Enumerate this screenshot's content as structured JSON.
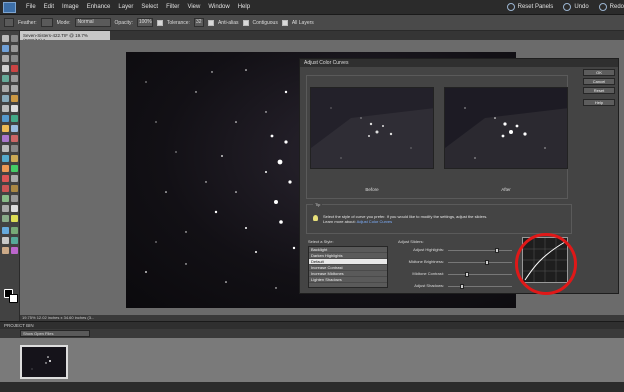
{
  "menubar": {
    "items": [
      "File",
      "Edit",
      "Image",
      "Enhance",
      "Layer",
      "Select",
      "Filter",
      "View",
      "Window",
      "Help"
    ],
    "right": [
      {
        "label": "Reset Panels",
        "icon": "reset-panels-icon"
      },
      {
        "label": "Undo",
        "icon": "undo-icon"
      },
      {
        "label": "Redo",
        "icon": "redo-icon"
      }
    ]
  },
  "options": {
    "feather_label": "Feather:",
    "mode_label": "Mode:",
    "mode_value": "Normal",
    "opacity_label": "Opacity:",
    "opacity_value": "100%",
    "tolerance_label": "Tolerance:",
    "tolerance_value": "32",
    "antialias_label": "Anti-alias",
    "contiguous_label": "Contiguous",
    "all_layers_label": "All Layers"
  },
  "document": {
    "tab_title": "Seven-Sisters-422.TIF @ 19.7% (RGB/16) *",
    "zoom": "19.75%",
    "dimensions": "12.02 inches x 34.60 inches (3..."
  },
  "dialog": {
    "title": "Adjust Color Curves",
    "buttons": {
      "ok": "OK",
      "cancel": "Cancel",
      "reset": "Reset",
      "help": "Help"
    },
    "before_label": "Before",
    "after_label": "After",
    "tip_title": "Tip",
    "tip_text": "Select the style of curve you prefer. If you would like to modify the settings, adjust the sliders.",
    "tip_learn": "Learn more about:",
    "tip_link": "Adjust Color Curves",
    "style_label": "Select a Style:",
    "styles": [
      "Backlight",
      "Darken Highlights",
      "Default",
      "Increase Contrast",
      "Increase Midtones",
      "Lighten Shadows"
    ],
    "selected_style": "Default",
    "sliders_label": "Adjust Sliders:",
    "sliders": [
      {
        "name": "Adjust Highlights:",
        "value": 0.78
      },
      {
        "name": "Midtone Brightness:",
        "value": 0.62
      },
      {
        "name": "Midtone Contrast:",
        "value": 0.28
      },
      {
        "name": "Adjust Shadows:",
        "value": 0.2
      }
    ]
  },
  "bin": {
    "header": "PROJECT BIN",
    "dropdown": "Show Open Files"
  },
  "colors": {
    "highlight_circle": "#e01818",
    "link": "#7fb0ff"
  }
}
